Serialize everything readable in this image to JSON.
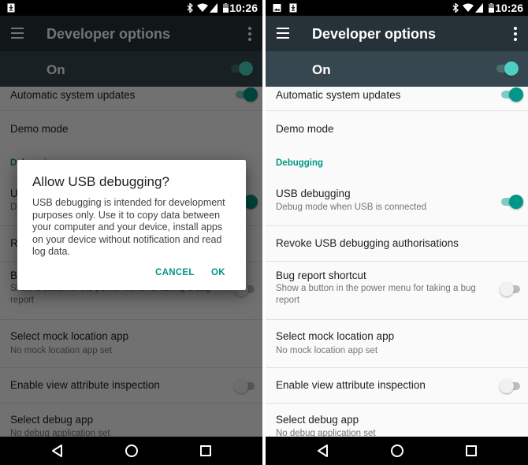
{
  "status_bar": {
    "time": "10:26",
    "icons": [
      "download-notification-icon",
      "bluetooth-icon",
      "wifi-icon",
      "cell-signal-icon",
      "battery-icon"
    ],
    "right_extra_icon": "image-notification-icon"
  },
  "app_bar": {
    "title": "Developer options",
    "menu_icon": "hamburger-menu-icon",
    "overflow_icon": "overflow-menu-icon"
  },
  "master_switch": {
    "label": "On",
    "checked": true
  },
  "settings": {
    "auto_updates": {
      "title": "Automatic system updates",
      "checked": true
    },
    "demo_mode": {
      "title": "Demo mode"
    },
    "debugging_header": "Debugging",
    "usb_debugging": {
      "title": "USB debugging",
      "summary": "Debug mode when USB is connected",
      "checked": true
    },
    "revoke": {
      "title": "Revoke USB debugging authorisations"
    },
    "bug_report": {
      "title": "Bug report shortcut",
      "summary": "Show a button in the power menu for taking a bug report",
      "checked": false
    },
    "mock_location": {
      "title": "Select mock location app",
      "summary": "No mock location app set"
    },
    "view_attr": {
      "title": "Enable view attribute inspection",
      "checked": false
    },
    "debug_app": {
      "title": "Select debug app",
      "summary": "No debug application set"
    }
  },
  "dialog": {
    "title": "Allow USB debugging?",
    "message": "USB debugging is intended for development purposes only. Use it to copy data between your computer and your device, install apps on your device without notification and read log data.",
    "cancel_label": "CANCEL",
    "ok_label": "OK"
  },
  "nav_bar": {
    "back_icon": "back-icon",
    "home_icon": "home-icon",
    "recents_icon": "recents-icon"
  },
  "colors": {
    "accent": "#009688",
    "app_bar": "#263238",
    "master_bar": "#37474f"
  }
}
